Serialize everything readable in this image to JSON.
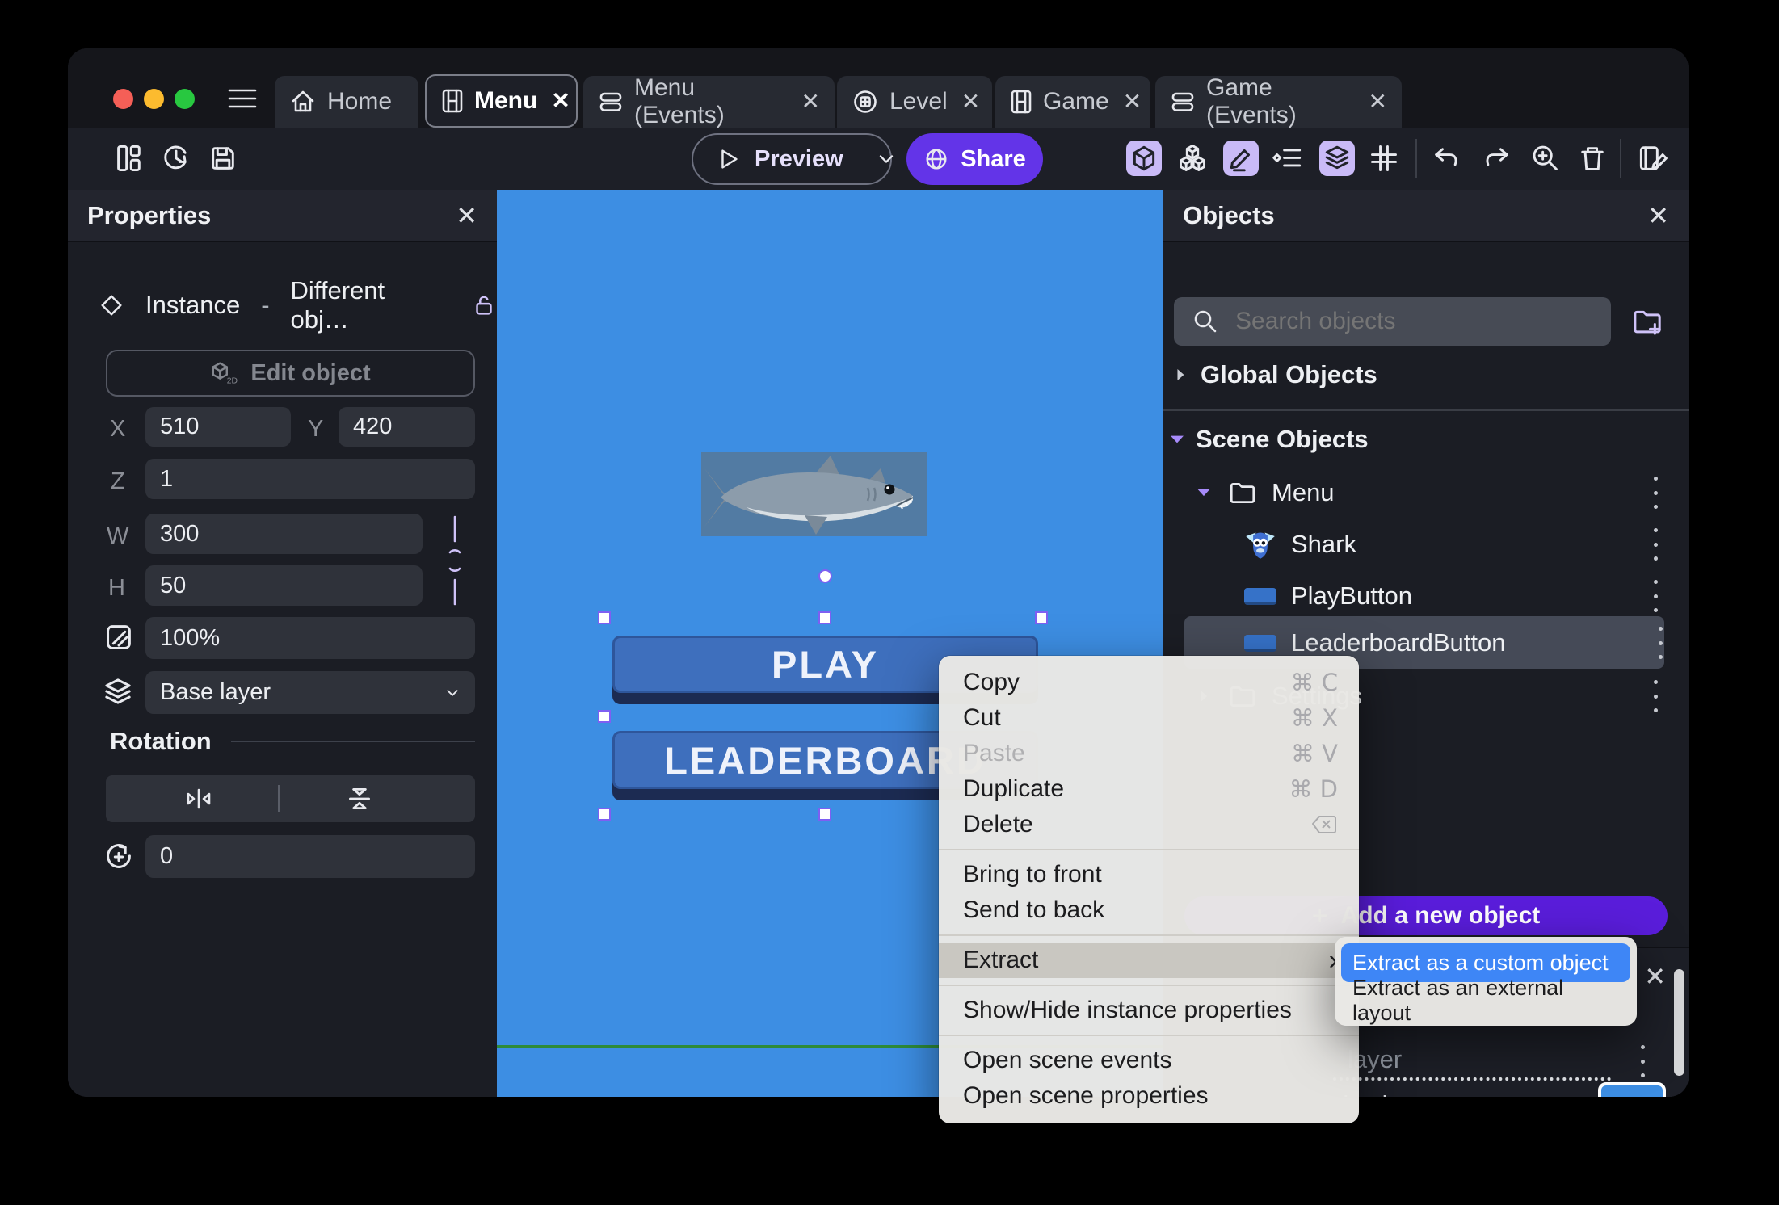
{
  "titlebar": {
    "tabs": [
      {
        "label": "Home",
        "icon": "home-icon",
        "closable": false,
        "active": false
      },
      {
        "label": "Menu",
        "icon": "film-icon",
        "closable": true,
        "active": true
      },
      {
        "label": "Menu (Events)",
        "icon": "events-icon",
        "closable": true,
        "active": false
      },
      {
        "label": "Level",
        "icon": "level-icon",
        "closable": true,
        "active": false
      },
      {
        "label": "Game",
        "icon": "film-icon",
        "closable": true,
        "active": false
      },
      {
        "label": "Game (Events)",
        "icon": "events-icon",
        "closable": true,
        "active": false
      }
    ],
    "close_glyph": "✕"
  },
  "toolbar": {
    "preview_label": "Preview",
    "share_label": "Share"
  },
  "properties": {
    "title": "Properties",
    "close_glyph": "✕",
    "instance_label": "Instance",
    "instance_sep": "-",
    "instance_value": "Different obj…",
    "edit_object_label": "Edit object",
    "x_label": "X",
    "x_value": "510",
    "y_label": "Y",
    "y_value": "420",
    "z_label": "Z",
    "z_value": "1",
    "w_label": "W",
    "w_value": "300",
    "h_label": "H",
    "h_value": "50",
    "opacity_value": "100%",
    "layer_value": "Base layer",
    "rotation_title": "Rotation",
    "rotation_value": "0"
  },
  "scene": {
    "play_label": "PLAY",
    "leaderboard_label": "LEADERBOARD"
  },
  "objects": {
    "title": "Objects",
    "close_glyph": "✕",
    "search_placeholder": "Search objects",
    "global_label": "Global Objects",
    "scene_label": "Scene Objects",
    "tree": [
      {
        "label": "Menu",
        "type": "folder",
        "expanded": true
      },
      {
        "label": "Shark",
        "type": "sprite"
      },
      {
        "label": "PlayButton",
        "type": "button"
      },
      {
        "label": "LeaderboardButton",
        "type": "button",
        "selected": true
      },
      {
        "label": "Settings",
        "type": "folder",
        "expanded": false
      }
    ],
    "add_label": "Add a new object",
    "add_plus": "+"
  },
  "bottom_panel": {
    "close_glyph": "✕",
    "layer_fragment": "layer",
    "color_fragment": "d color",
    "swatch_color": "#3d8ee3"
  },
  "menu": {
    "items": [
      {
        "label": "Copy",
        "shortcut": "⌘ C"
      },
      {
        "label": "Cut",
        "shortcut": "⌘ X"
      },
      {
        "label": "Paste",
        "shortcut": "⌘ V",
        "disabled": true
      },
      {
        "label": "Duplicate",
        "shortcut": "⌘ D"
      },
      {
        "label": "Delete",
        "shortcut_icon": "delete-key-icon"
      },
      {
        "label": "Bring to front"
      },
      {
        "label": "Send to back"
      },
      {
        "label": "Extract",
        "has_submenu": true,
        "highlighted": true,
        "arrow": "›"
      },
      {
        "label": "Show/Hide instance properties"
      },
      {
        "label": "Open scene events"
      },
      {
        "label": "Open scene properties"
      }
    ]
  },
  "submenu": {
    "items": [
      {
        "label": "Extract as a custom object",
        "selected": true
      },
      {
        "label": "Extract as an external layout",
        "selected": false
      }
    ]
  },
  "colors": {
    "canvas_blue": "#3d8ee3",
    "share_purple": "#6334e8",
    "add_purple": "#5a1ddb",
    "selection_purple": "#7e5ff2",
    "submenu_highlight_blue": "#3e86f6",
    "game_button_blue": "#3e6fbd",
    "game_button_shadow": "#1c2b52",
    "guide_green": "#2e8b3a",
    "tool_active_bg": "#c9baf7"
  }
}
